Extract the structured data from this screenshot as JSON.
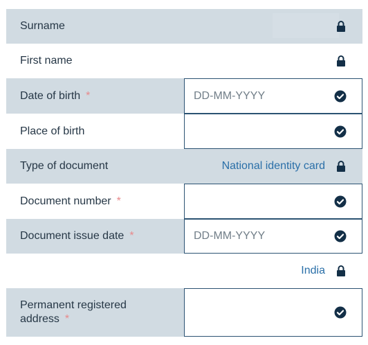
{
  "colors": {
    "shaded_row": "#d1dbe2",
    "label": "#263746",
    "required_asterisk": "#e8898b",
    "value_link": "#2a6fa8",
    "field_border": "#2b5272",
    "icon": "#132f47"
  },
  "required_marker": "*",
  "fields": {
    "surname": {
      "label": "Surname",
      "icon": "lock-icon"
    },
    "first_name": {
      "label": "First name",
      "icon": "lock-icon"
    },
    "date_of_birth": {
      "label": "Date of birth",
      "placeholder": "DD-MM-YYYY",
      "value": "",
      "icon": "check-circle-icon"
    },
    "place_of_birth": {
      "label": "Place of birth",
      "placeholder": "",
      "value": "",
      "icon": "check-circle-icon"
    },
    "type_of_document": {
      "label": "Type of document",
      "value": "National identity card",
      "icon": "lock-icon"
    },
    "document_number": {
      "label": "Document number",
      "placeholder": "",
      "value": "",
      "icon": "check-circle-icon"
    },
    "document_issue_date": {
      "label": "Document issue date",
      "placeholder": "DD-MM-YYYY",
      "value": "",
      "icon": "check-circle-icon"
    },
    "country": {
      "label": "",
      "value": "India",
      "icon": "lock-icon"
    },
    "permanent_address": {
      "label_line1": "Permanent registered",
      "label_line2": "address",
      "placeholder": "",
      "value": "",
      "icon": "check-circle-icon"
    }
  }
}
